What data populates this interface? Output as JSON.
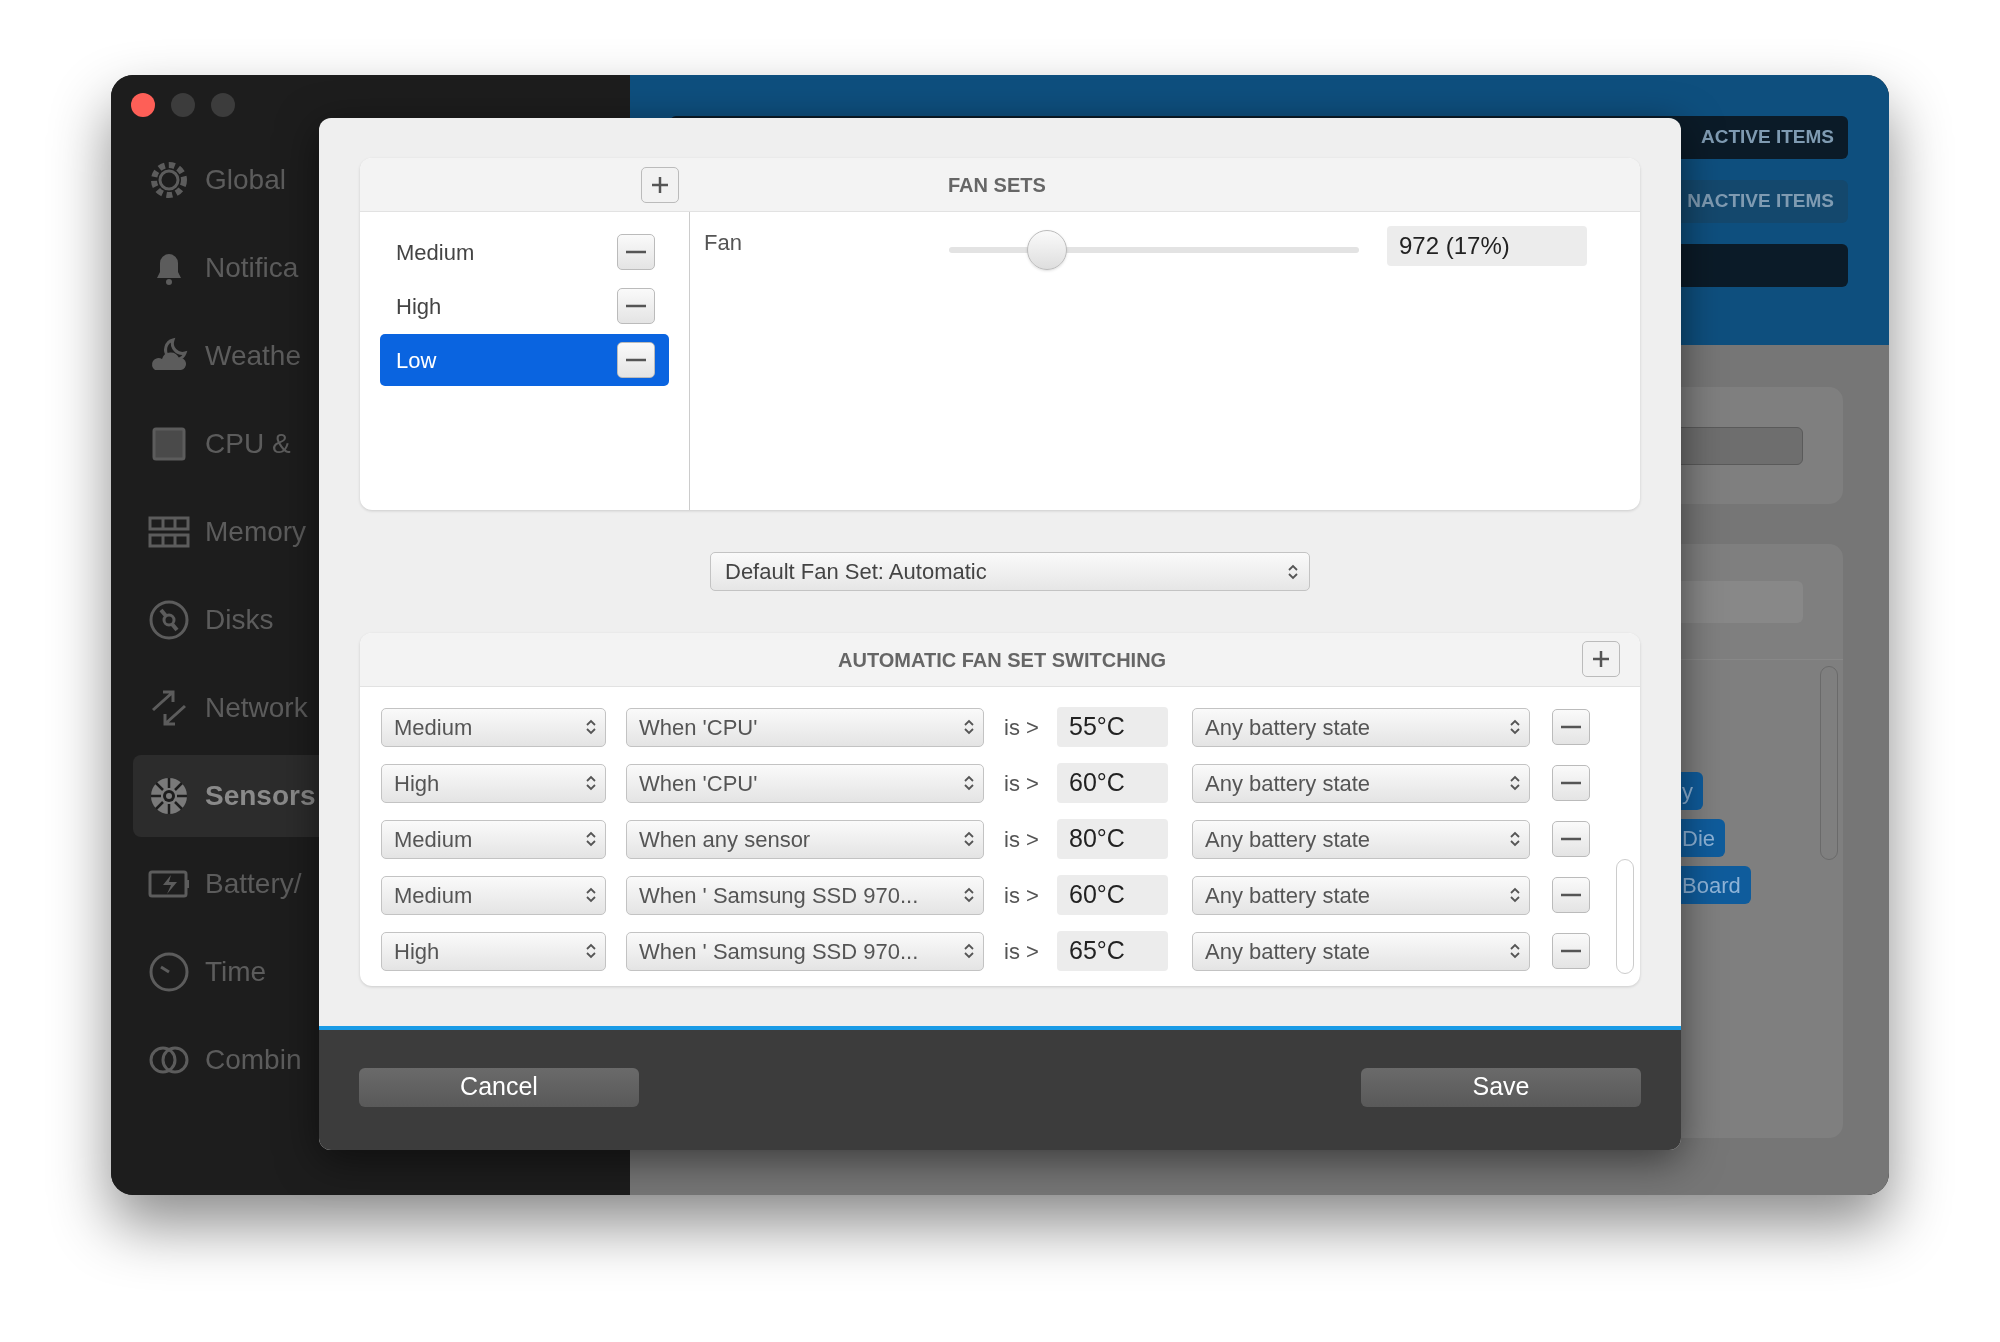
{
  "window": {
    "sidebar": {
      "items": [
        {
          "label": "Global",
          "selected": false
        },
        {
          "label": "Notifica",
          "selected": false
        },
        {
          "label": "Weathe",
          "selected": false
        },
        {
          "label": "CPU &",
          "selected": false
        },
        {
          "label": "Memory",
          "selected": false
        },
        {
          "label": "Disks",
          "selected": false
        },
        {
          "label": "Network",
          "selected": false
        },
        {
          "label": "Sensors",
          "selected": true
        },
        {
          "label": "Battery/",
          "selected": false
        },
        {
          "label": "Time",
          "selected": false
        },
        {
          "label": "Combin",
          "selected": false
        }
      ]
    },
    "toolbar": {
      "buttons": [
        {
          "label": "ACTIVE ITEMS",
          "selected": true
        },
        {
          "label": "NACTIVE ITEMS",
          "selected": false
        }
      ]
    },
    "tags": [
      "y",
      "Die",
      "Board"
    ]
  },
  "dialog": {
    "fan_sets": {
      "title": "FAN SETS",
      "items": [
        {
          "label": "Medium",
          "selected": false
        },
        {
          "label": "High",
          "selected": false
        },
        {
          "label": "Low",
          "selected": true
        }
      ],
      "fans": [
        {
          "label": "Fan",
          "level": 0.21,
          "reading": "972 (17%)"
        }
      ]
    },
    "default_fan_set": "Default Fan Set: Automatic",
    "switching": {
      "title": "AUTOMATIC FAN SET SWITCHING",
      "rules": [
        {
          "fan_set": "Medium",
          "sensor": "When 'CPU'",
          "operator": "is >",
          "threshold": "55°C",
          "battery": "Any battery state"
        },
        {
          "fan_set": "High",
          "sensor": "When 'CPU'",
          "operator": "is >",
          "threshold": "60°C",
          "battery": "Any battery state"
        },
        {
          "fan_set": "Medium",
          "sensor": "When any sensor",
          "operator": "is >",
          "threshold": "80°C",
          "battery": "Any battery state"
        },
        {
          "fan_set": "Medium",
          "sensor": "When ' Samsung SSD 970...",
          "operator": "is >",
          "threshold": "60°C",
          "battery": "Any battery state"
        },
        {
          "fan_set": "High",
          "sensor": "When ' Samsung SSD 970...",
          "operator": "is >",
          "threshold": "65°C",
          "battery": "Any battery state"
        }
      ]
    },
    "buttons": {
      "cancel": "Cancel",
      "save": "Save"
    }
  }
}
